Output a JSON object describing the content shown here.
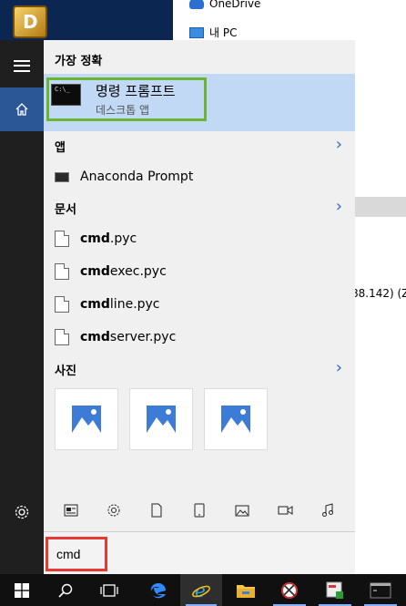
{
  "desktop": {
    "explorer_items": [
      "OneDrive",
      "내 PC"
    ],
    "side_text": "88.142) (Z"
  },
  "start_menu": {
    "best_match_heading": "가장 정확",
    "best_match": {
      "title": "명령 프롬프트",
      "subtitle": "데스크톱 앱",
      "icon_text": "C:\\_"
    },
    "apps_heading": "앱",
    "apps": [
      {
        "label": "Anaconda Prompt"
      }
    ],
    "documents_heading": "문서",
    "documents": [
      {
        "match": "cmd",
        "rest": ".pyc"
      },
      {
        "match": "cmd",
        "rest": "exec.pyc"
      },
      {
        "match": "cmd",
        "rest": "line.pyc"
      },
      {
        "match": "cmd",
        "rest": "server.pyc"
      }
    ],
    "photos_heading": "사진",
    "photo_count": 3,
    "filters": [
      "news-icon",
      "settings-icon",
      "document-icon",
      "tablet-icon",
      "photo-icon",
      "video-icon",
      "music-icon"
    ]
  },
  "search": {
    "value": "cmd"
  },
  "taskbar": {
    "items": [
      "windows-start-icon",
      "search-icon",
      "task-view-icon",
      "edge-icon",
      "internet-explorer-icon",
      "file-explorer-icon",
      "snipping-tool-icon",
      "presentation-app-icon",
      "command-prompt-icon"
    ]
  },
  "colors": {
    "accent": "#2b5796",
    "highlight": "#c1d9f4",
    "green_box": "#6ab62e",
    "red_box": "#e53935"
  }
}
